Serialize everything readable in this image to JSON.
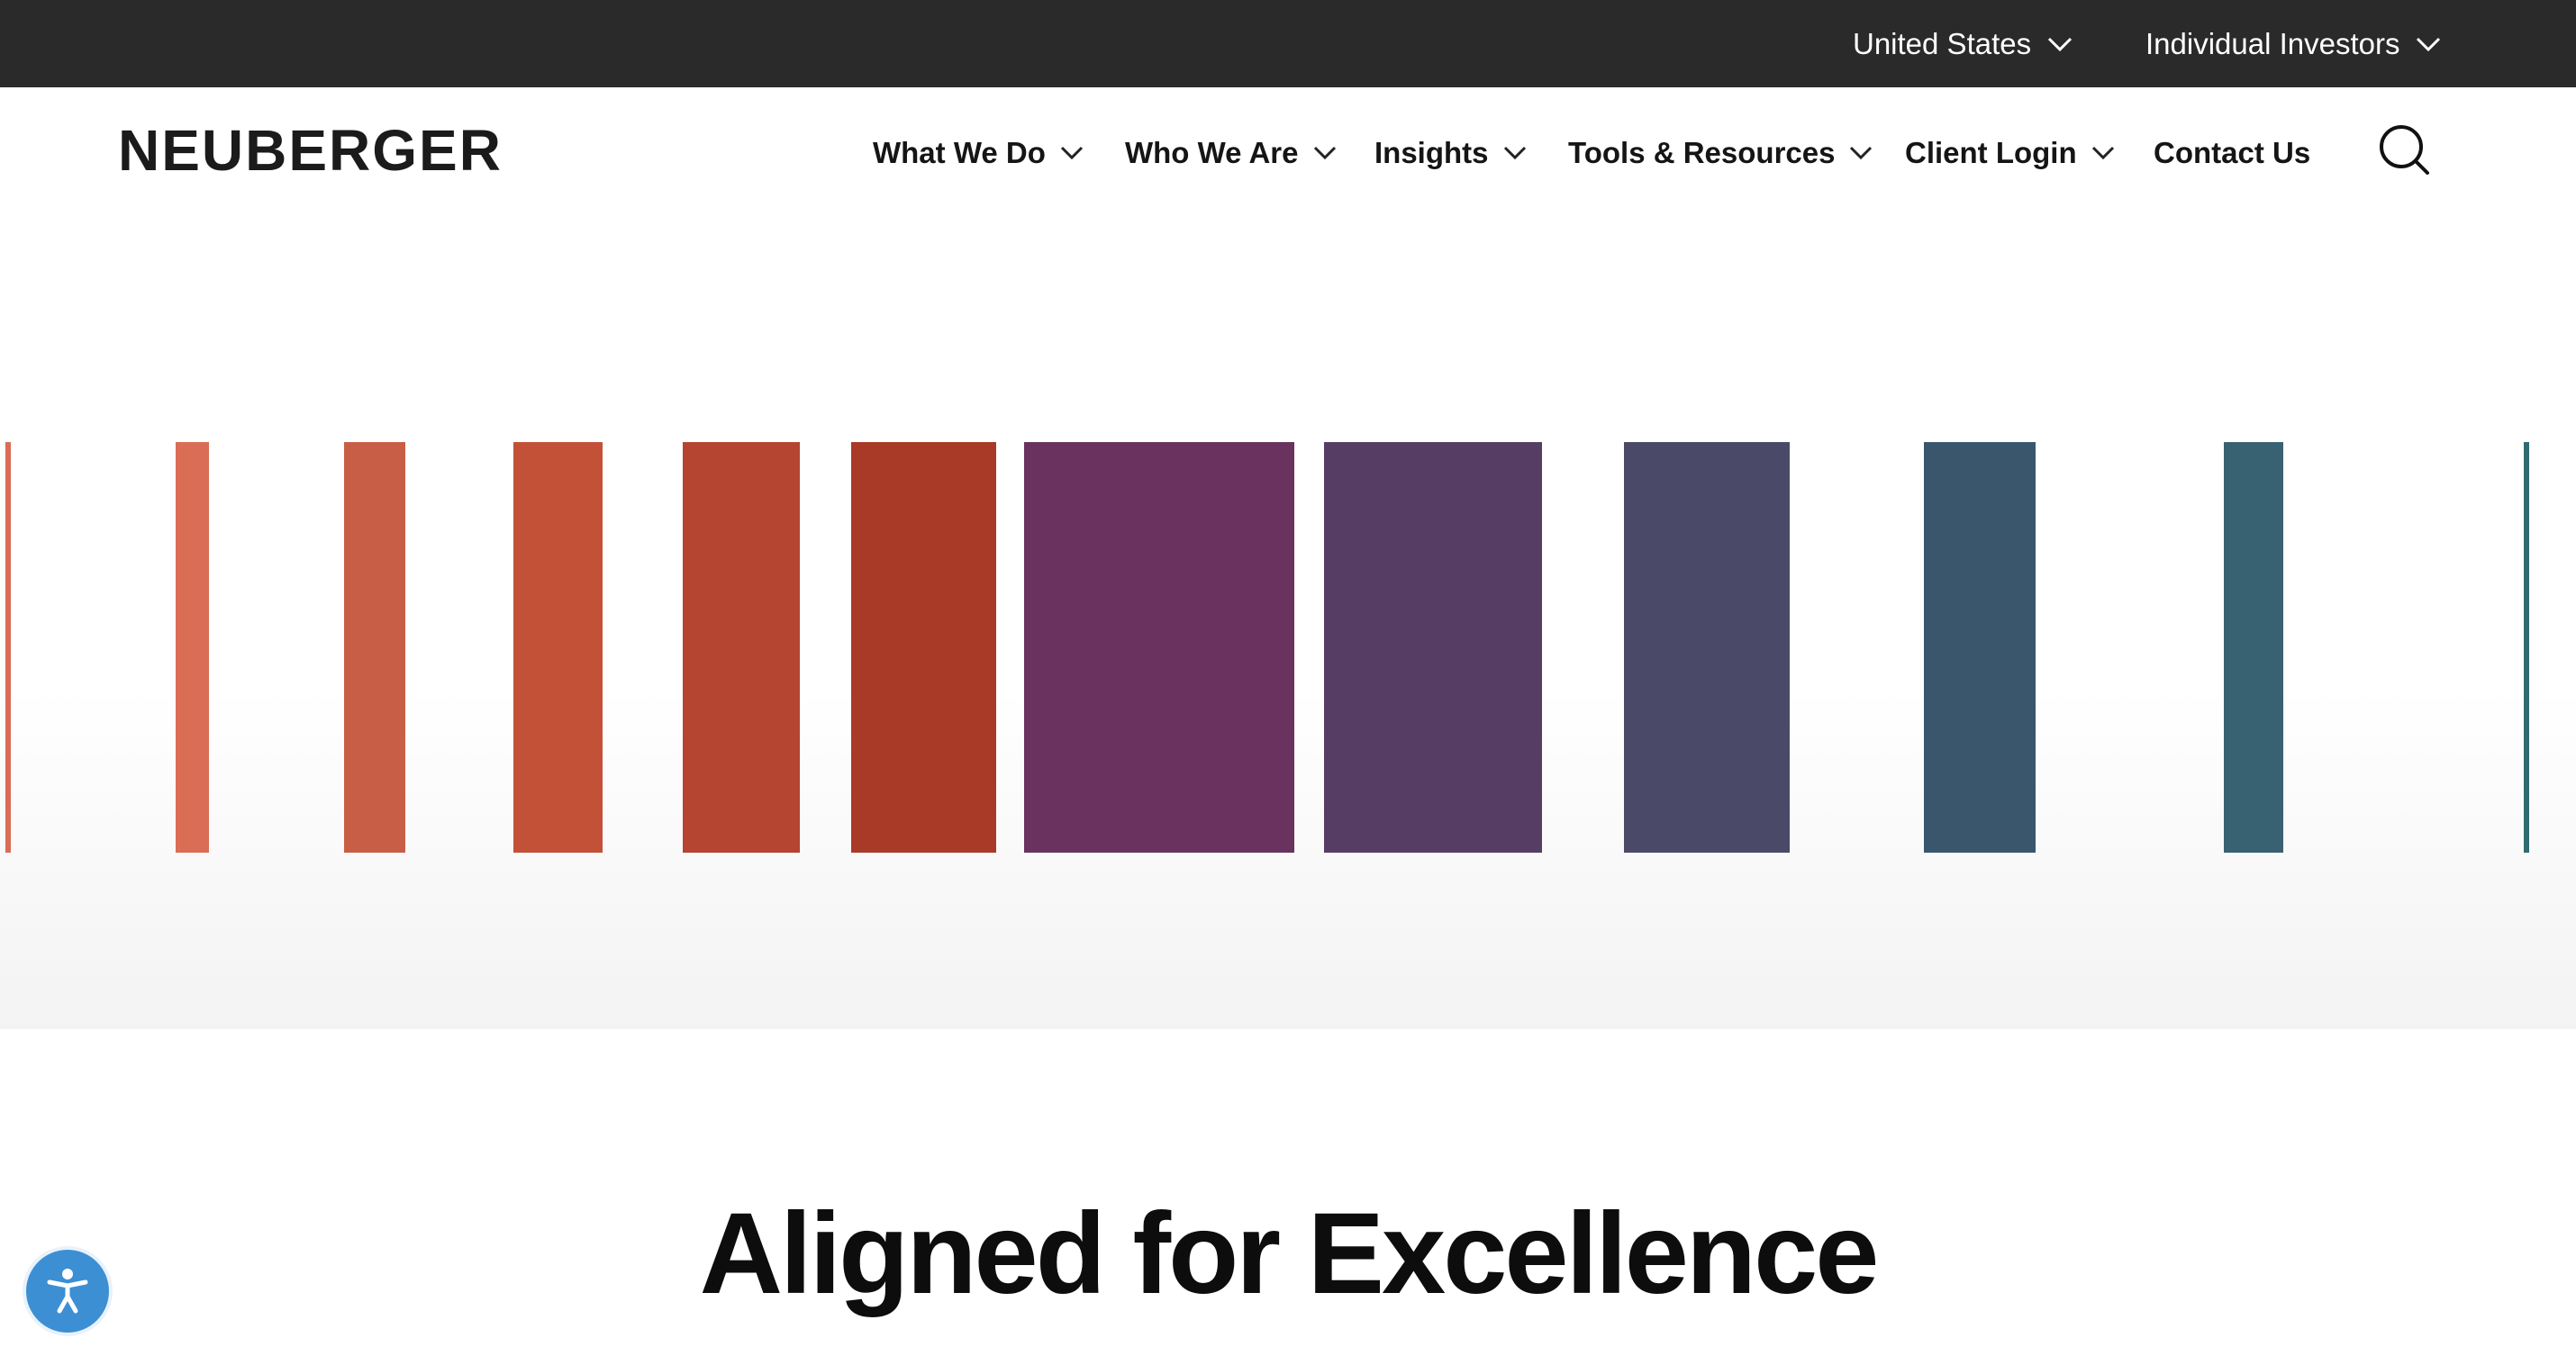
{
  "utility": {
    "region_label": "United States",
    "audience_label": "Individual Investors"
  },
  "header": {
    "logo_text": "NEUBERGER",
    "nav": [
      {
        "label": "What We Do"
      },
      {
        "label": "Who We Are"
      },
      {
        "label": "Insights"
      },
      {
        "label": "Tools & Resources"
      },
      {
        "label": "Client Login"
      },
      {
        "label": "Contact Us"
      }
    ]
  },
  "hero": {
    "bar_colors": [
      "#d96d55",
      "#d96d55",
      "#c95e46",
      "#c25137",
      "#b54431",
      "#a83a27",
      "#69325f",
      "#563d64",
      "#4a4a68",
      "#3a566c",
      "#386272",
      "#2f6b70"
    ]
  },
  "main": {
    "headline": "Aligned for Excellence"
  },
  "icons": {
    "search": "search-icon",
    "chevron": "chevron-down-icon",
    "accessibility": "accessibility-icon"
  }
}
